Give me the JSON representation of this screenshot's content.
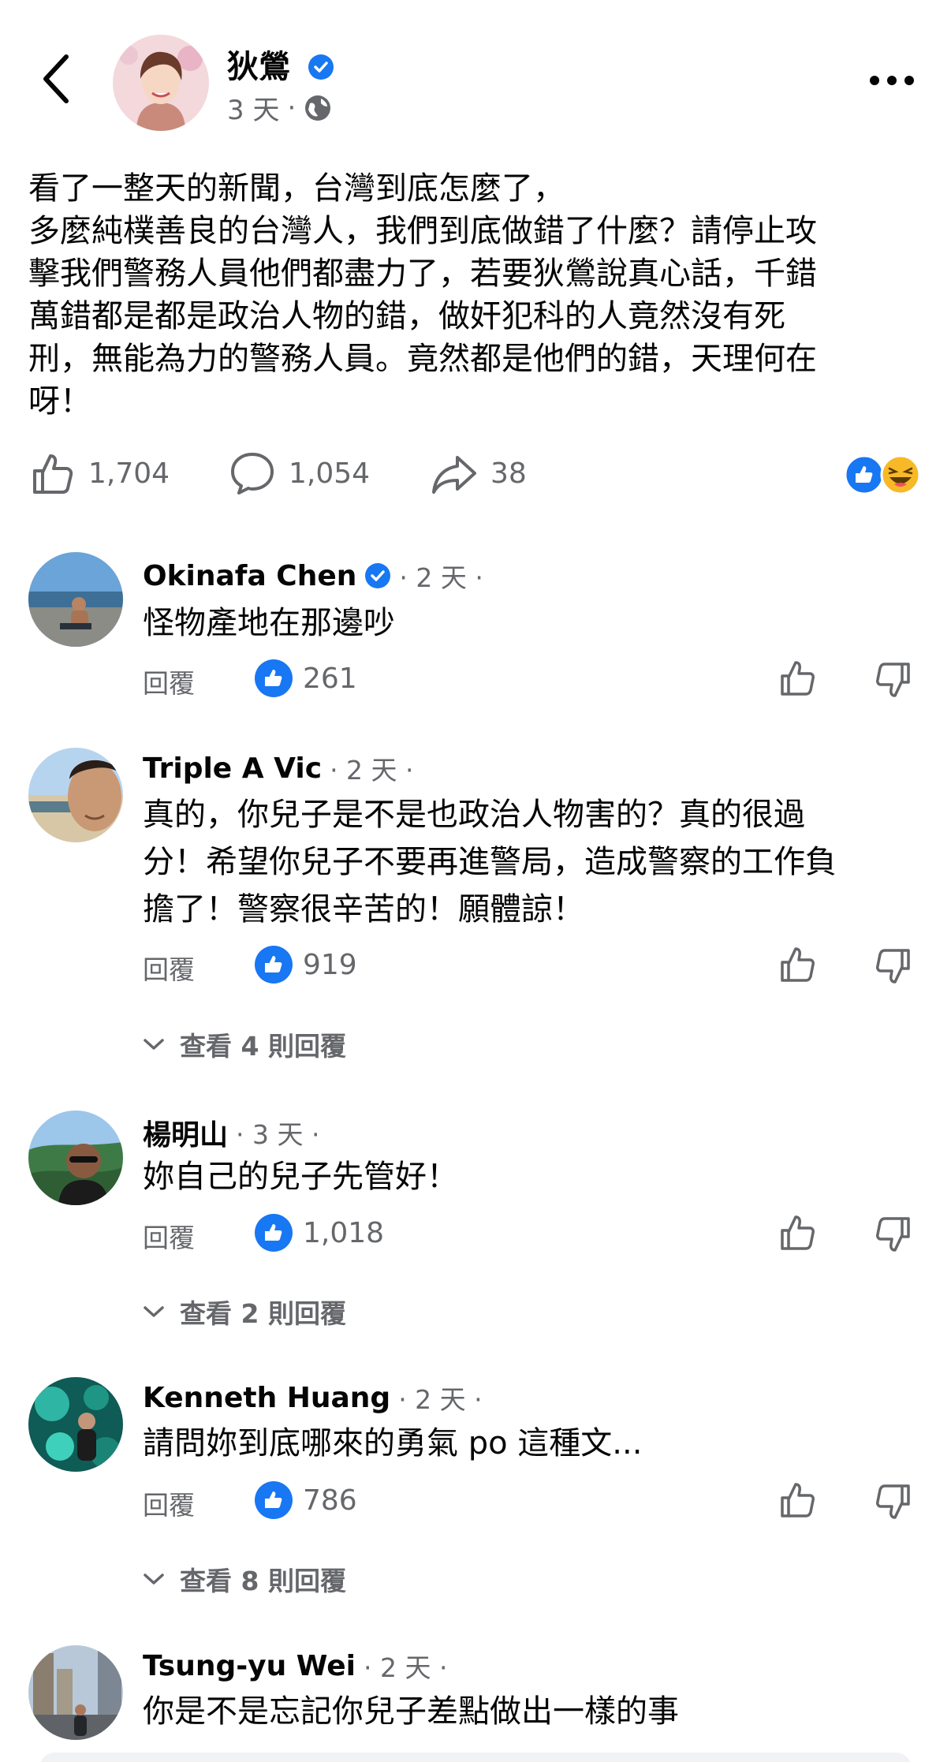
{
  "header": {
    "author": "狄鶯",
    "time": "3 天",
    "dot": "·"
  },
  "post": {
    "lines": [
      "看了一整天的新聞，台灣到底怎麼了，",
      "多麼純樸善良的台灣人，我們到底做錯了什麼？請停止攻",
      "擊我們警務人員他們都盡力了，若要狄鶯說真心話，千錯",
      "萬錯都是都是政治人物的錯，做奸犯科的人竟然沒有死",
      "刑，無能為力的警務人員。竟然都是他們的錯，天理何在",
      "呀！"
    ],
    "likes": "1,704",
    "comments": "1,054",
    "shares": "38"
  },
  "labels": {
    "reply": "回覆"
  },
  "comments": [
    {
      "name": "Okinafa Chen",
      "meta": "· 2 天 ·",
      "lines": [
        "怪物產地在那邊吵"
      ],
      "likes": "261"
    },
    {
      "name": "Triple A Vic",
      "meta": "· 2 天 ·",
      "lines": [
        "真的，你兒子是不是也政治人物害的？真的很過",
        "分！希望你兒子不要再進警局，造成警察的工作負",
        "擔了！警察很辛苦的！願體諒！"
      ],
      "likes": "919",
      "view_replies": "查看 4 則回覆"
    },
    {
      "name": "楊明山",
      "meta": "· 3 天 ·",
      "lines": [
        "妳自己的兒子先管好！"
      ],
      "likes": "1,018",
      "view_replies": "查看 2 則回覆"
    },
    {
      "name": "Kenneth Huang",
      "meta": "· 2 天 ·",
      "lines": [
        "請問妳到底哪來的勇氣 po 這種文..."
      ],
      "likes": "786",
      "view_replies": "查看 8 則回覆"
    },
    {
      "name": "Tsung-yu Wei",
      "meta": "· 2 天 ·",
      "lines": [
        "你是不是忘記你兒子差點做出一樣的事"
      ]
    }
  ],
  "colors": {
    "facebook_blue": "#1877f2",
    "secondary_text": "#65676b",
    "primary_text": "#050505"
  }
}
